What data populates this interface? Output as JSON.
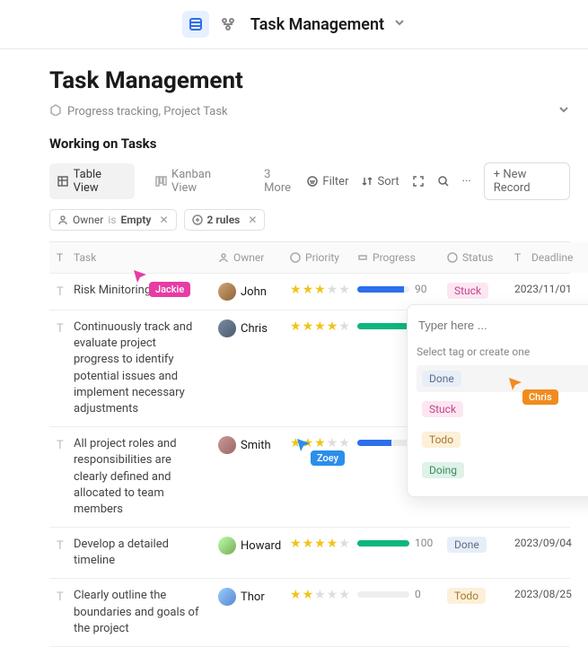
{
  "topbar": {
    "title": "Task Management"
  },
  "page": {
    "title": "Task Management",
    "tags": "Progress tracking, Project Task",
    "section": "Working on Tasks"
  },
  "views": {
    "table": "Table View",
    "kanban": "Kanban View",
    "more": "3 More"
  },
  "toolbar": {
    "filter": "Filter",
    "sort": "Sort",
    "new_record": "New Record"
  },
  "filters": {
    "owner_field": "Owner",
    "owner_op": "is",
    "owner_val": "Empty",
    "rules": "2 rules"
  },
  "columns": {
    "task": "Task",
    "owner": "Owner",
    "priority": "Priority",
    "progress": "Progress",
    "status": "Status",
    "deadline": "Deadline"
  },
  "rows": [
    {
      "task": "Risk Minitoring",
      "owner": "John",
      "stars": 3,
      "progress": 90,
      "pcolor": "blue",
      "status": "Stuck",
      "stclass": "st-stuck",
      "deadline": "2023/11/01"
    },
    {
      "task": "Continuously track and evaluate project progress to identify potential issues and implement necessary adjustments",
      "owner": "Chris",
      "stars": 4,
      "progress": 100,
      "pcolor": "green",
      "status": "",
      "stclass": "",
      "deadline": ""
    },
    {
      "task": "All project roles and responsibilities are clearly defined and allocated to team members",
      "owner": "Smith",
      "stars": 3,
      "progress": 66,
      "pcolor": "blue",
      "status": "",
      "stclass": "",
      "deadline": ""
    },
    {
      "task": "Develop a detailed timeline",
      "owner": "Howard",
      "stars": 4,
      "progress": 100,
      "pcolor": "green",
      "status": "Done",
      "stclass": "st-done",
      "deadline": "2023/09/04"
    },
    {
      "task": "Clearly outline the boundaries and goals of the project",
      "owner": "Thor",
      "stars": 2,
      "progress": 0,
      "pcolor": "blue",
      "status": "Todo",
      "stclass": "st-todo",
      "deadline": "2023/08/25"
    }
  ],
  "dropdown": {
    "placeholder": "Typer here ...",
    "hint": "Select tag or create one",
    "options": [
      {
        "label": "Done",
        "class": "st-done"
      },
      {
        "label": "Stuck",
        "class": "st-stuck"
      },
      {
        "label": "Todo",
        "class": "st-todo"
      },
      {
        "label": "Doing",
        "class": "st-doing"
      }
    ]
  },
  "cursors": {
    "jackie": {
      "name": "Jackie",
      "color": "#e73ca3"
    },
    "zoey": {
      "name": "Zoey",
      "color": "#2c8eeb"
    },
    "chris": {
      "name": "Chris",
      "color": "#f08c1e"
    }
  }
}
